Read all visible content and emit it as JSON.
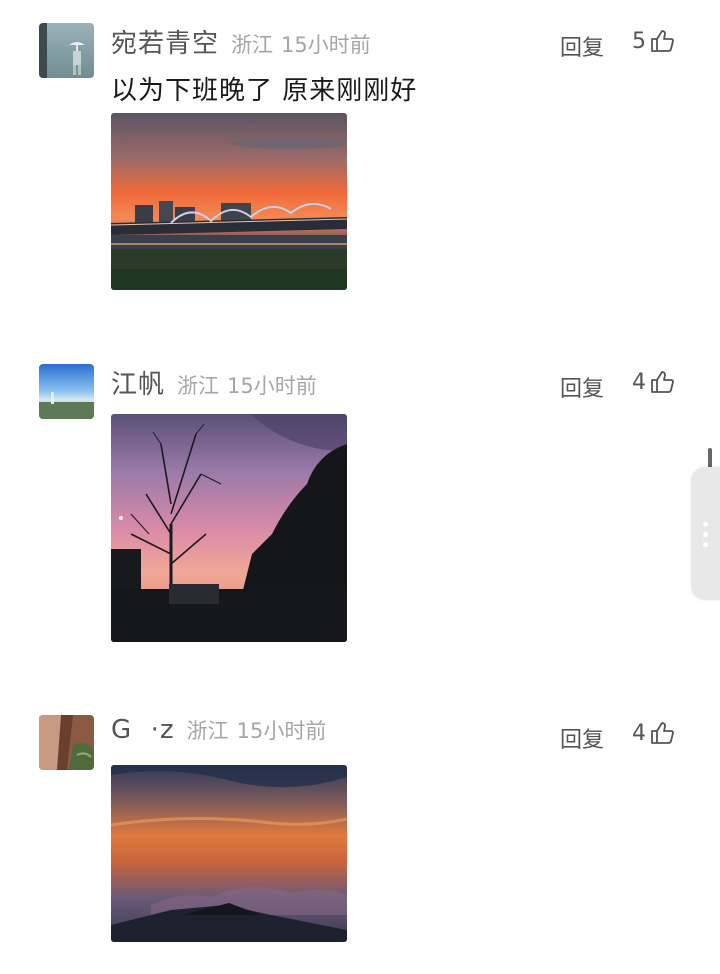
{
  "comments": [
    {
      "username": "宛若青空",
      "location": "浙江",
      "time": "15小时前",
      "reply_label": "回复",
      "likes": "5",
      "text": "以为下班晚了 原来刚刚好",
      "avatar_icon": "umbrella-figure-avatar",
      "photo_icon": "bridge-sunset-photo"
    },
    {
      "username": "江帆",
      "location": "浙江",
      "time": "15小时前",
      "reply_label": "回复",
      "likes": "4",
      "text": "",
      "avatar_icon": "seaside-avatar",
      "photo_icon": "tree-silhouette-sunset-photo"
    },
    {
      "username": "G  ·z",
      "location": "浙江",
      "time": "15小时前",
      "reply_label": "回复",
      "likes": "4",
      "text": "",
      "avatar_icon": "leaf-avatar",
      "photo_icon": "mountain-sunset-photo"
    }
  ],
  "colors": {
    "username": "#555555",
    "meta": "#a6a6a6",
    "text": "#1a1a1a"
  }
}
